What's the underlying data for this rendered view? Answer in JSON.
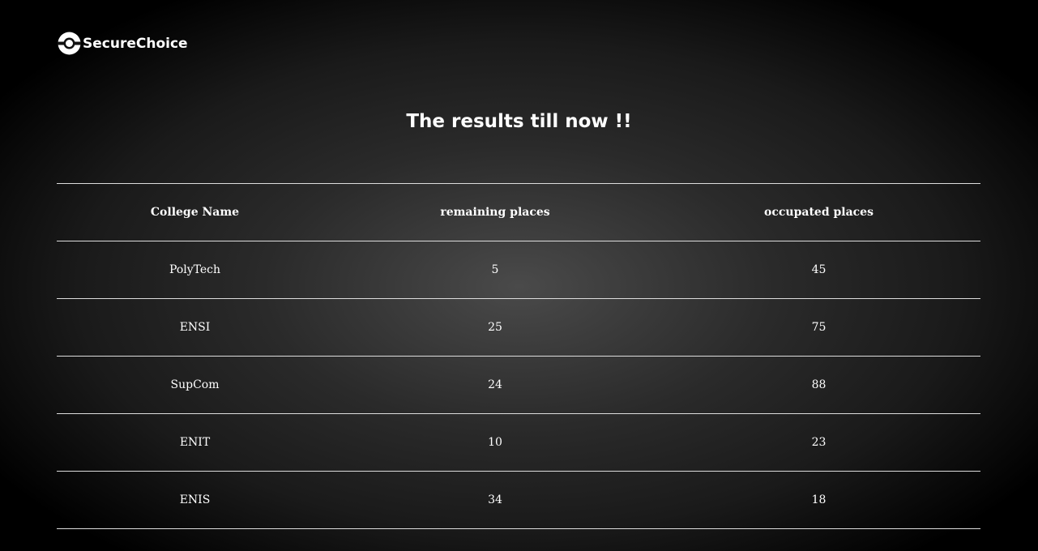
{
  "brand": {
    "name": "SecureChoice",
    "icon": "logo-icon"
  },
  "page_title": "The results till now !!",
  "table": {
    "headers": [
      "College Name",
      "remaining places",
      "occupated places"
    ],
    "rows": [
      [
        "PolyTech",
        "5",
        "45"
      ],
      [
        "ENSI",
        "25",
        "75"
      ],
      [
        "SupCom",
        "24",
        "88"
      ],
      [
        "ENIT",
        "10",
        "23"
      ],
      [
        "ENIS",
        "34",
        "18"
      ]
    ]
  }
}
